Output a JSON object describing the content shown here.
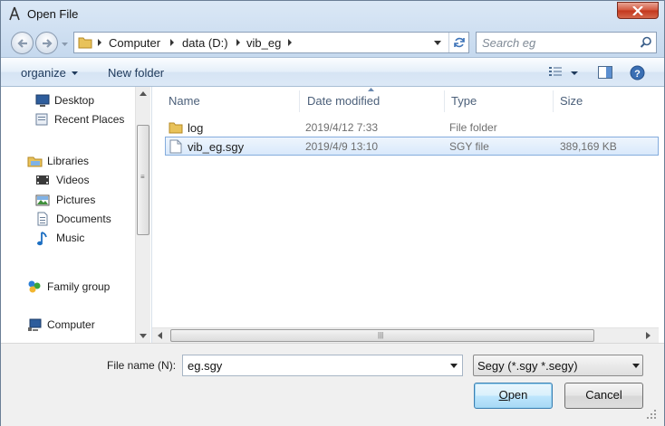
{
  "window": {
    "title": "Open File"
  },
  "nav": {
    "breadcrumbs": [
      "Computer",
      "data (D:)",
      "vib_eg"
    ],
    "search_placeholder": "Search eg"
  },
  "toolbar": {
    "organize": "organize",
    "new_folder": "New folder"
  },
  "sidebar": {
    "items": [
      {
        "label": "Desktop",
        "icon": "desktop-icon"
      },
      {
        "label": "Recent Places",
        "icon": "recent-places-icon"
      },
      {
        "label": "Libraries",
        "icon": "libraries-icon"
      },
      {
        "label": "Videos",
        "icon": "videos-icon"
      },
      {
        "label": "Pictures",
        "icon": "pictures-icon"
      },
      {
        "label": "Documents",
        "icon": "documents-icon"
      },
      {
        "label": "Music",
        "icon": "music-icon"
      },
      {
        "label": "Family group",
        "icon": "homegroup-icon"
      },
      {
        "label": "Computer",
        "icon": "computer-icon"
      }
    ]
  },
  "columns": [
    "Name",
    "Date modified",
    "Type",
    "Size"
  ],
  "files": [
    {
      "name": "log",
      "date": "2019/4/12 7:33",
      "type": "File folder",
      "size": "",
      "icon": "folder-icon",
      "selected": false
    },
    {
      "name": "vib_eg.sgy",
      "date": "2019/4/9 13:10",
      "type": "SGY file",
      "size": "389,169 KB",
      "icon": "file-icon",
      "selected": true
    }
  ],
  "footer": {
    "filename_label": "File name",
    "filename_hotkey": "(N):",
    "filename_value": "eg.sgy",
    "filter_value": "Segy (*.sgy *.segy)",
    "open_label_hotkey": "O",
    "open_label_rest": "pen",
    "cancel_label": "Cancel"
  },
  "colors": {
    "selection": "#d9e9fb",
    "selection_border": "#84acdd",
    "close": "#c3361b"
  }
}
